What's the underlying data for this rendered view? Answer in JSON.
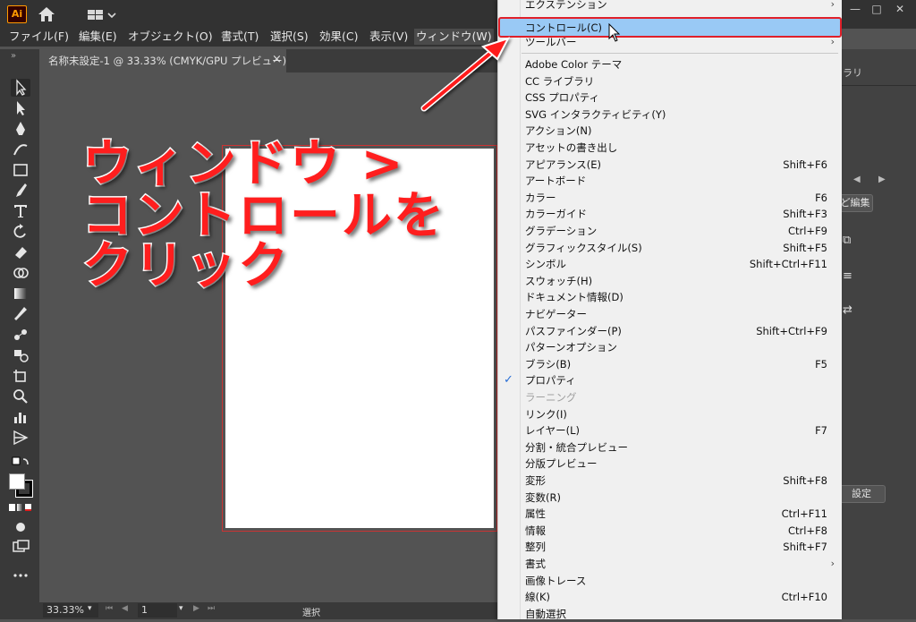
{
  "app": {
    "logo": "Ai",
    "menu": [
      "ファイル(F)",
      "編集(E)",
      "オブジェクト(O)",
      "書式(T)",
      "選択(S)",
      "効果(C)",
      "表示(V)",
      "ウィンドウ(W)"
    ],
    "window_controls": [
      "minimize",
      "maximize",
      "close"
    ]
  },
  "document": {
    "tab_title": "名称未設定-1 @ 33.33% (CMYK/GPU プレビュー)",
    "tab_close": "×"
  },
  "status": {
    "zoom": "33.33%",
    "page": "1",
    "mode": "選択"
  },
  "right_panel": {
    "tab_fragment": "ラリ",
    "edit_btn": "ど編集",
    "setting_btn": "設定"
  },
  "dropdown": {
    "top_item": {
      "label": "エクステンション",
      "submenu": "›"
    },
    "highlighted": {
      "label": "コントロール(C)"
    },
    "items": [
      {
        "label": "ツールバー",
        "submenu": "›"
      },
      {
        "label": "Adobe Color テーマ"
      },
      {
        "label": "CC ライブラリ"
      },
      {
        "label": "CSS プロパティ"
      },
      {
        "label": "SVG インタラクティビティ(Y)"
      },
      {
        "label": "アクション(N)"
      },
      {
        "label": "アセットの書き出し"
      },
      {
        "label": "アピアランス(E)",
        "shortcut": "Shift+F6"
      },
      {
        "label": "アートボード"
      },
      {
        "label": "カラー",
        "shortcut": "F6"
      },
      {
        "label": "カラーガイド",
        "shortcut": "Shift+F3"
      },
      {
        "label": "グラデーション",
        "shortcut": "Ctrl+F9"
      },
      {
        "label": "グラフィックスタイル(S)",
        "shortcut": "Shift+F5"
      },
      {
        "label": "シンボル",
        "shortcut": "Shift+Ctrl+F11"
      },
      {
        "label": "スウォッチ(H)"
      },
      {
        "label": "ドキュメント情報(D)"
      },
      {
        "label": "ナビゲーター"
      },
      {
        "label": "パスファインダー(P)",
        "shortcut": "Shift+Ctrl+F9"
      },
      {
        "label": "パターンオプション"
      },
      {
        "label": "ブラシ(B)",
        "shortcut": "F5"
      },
      {
        "label": "プロパティ",
        "checked": "✓"
      },
      {
        "label": "ラーニング",
        "disabled": true
      },
      {
        "label": "リンク(I)"
      },
      {
        "label": "レイヤー(L)",
        "shortcut": "F7"
      },
      {
        "label": "分割・統合プレビュー"
      },
      {
        "label": "分版プレビュー"
      },
      {
        "label": "変形",
        "shortcut": "Shift+F8"
      },
      {
        "label": "変数(R)"
      },
      {
        "label": "属性",
        "shortcut": "Ctrl+F11"
      },
      {
        "label": "情報",
        "shortcut": "Ctrl+F8"
      },
      {
        "label": "整列",
        "shortcut": "Shift+F7"
      },
      {
        "label": "書式",
        "submenu": "›"
      },
      {
        "label": "画像トレース"
      },
      {
        "label": "線(K)",
        "shortcut": "Ctrl+F10"
      },
      {
        "label": "自動選択"
      }
    ]
  },
  "annotation": {
    "lines": [
      "ウィンドウ >",
      "コントロールを",
      "クリック"
    ],
    "color": "#ff1e1e"
  }
}
